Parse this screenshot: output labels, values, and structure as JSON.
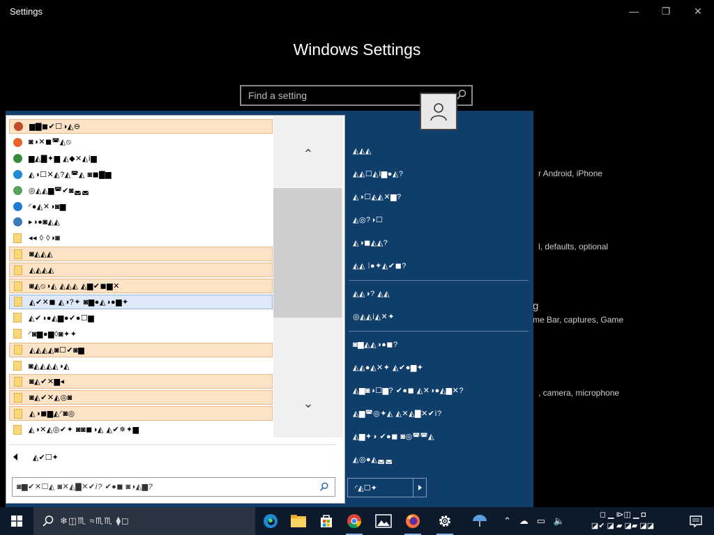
{
  "window": {
    "title": "Settings",
    "minimize": "—",
    "maximize": "❐",
    "close": "✕",
    "heading": "Windows Settings",
    "search_placeholder": "Find a setting",
    "bg_text": [
      "r Android, iPhone",
      "l, defaults, optional",
      "g",
      "me Bar, captures, Game",
      ", camera, microphone"
    ]
  },
  "start_menu": {
    "jump_list": [
      {
        "label": "▆▇◼✔☐◑◭⊖",
        "icon": "headphones-app-icon",
        "icon_color": "#c04a2a",
        "highlight": "hl"
      },
      {
        "label": "◙◑✕◼◚◭⦸",
        "icon": "firefox-icon",
        "icon_color": "#e8642a",
        "highlight": ""
      },
      {
        "label": "▆◭▇✦▆ ◭◆✕◭ⅰ▆",
        "icon": "chrome-icon",
        "icon_color": "#3b8a3b",
        "highlight": ""
      },
      {
        "label": "◭◑☐✕◭?◭◚◭ ◙◼▇▆",
        "icon": "edge-icon",
        "icon_color": "#1f8bd6",
        "highlight": ""
      },
      {
        "label": "◎◭◭▆◚✔◙◛◛",
        "icon": "notepad-icon",
        "icon_color": "#5aa05a",
        "highlight": ""
      },
      {
        "label": "◜●◭✕◑◙▆",
        "icon": "onedrive-icon",
        "icon_color": "#1f7ad6",
        "highlight": ""
      },
      {
        "label": "▸◑●◙◭◭",
        "icon": "app-installer-icon",
        "icon_color": "#3a7ab8",
        "highlight": ""
      },
      {
        "label": "◂◂ ◊ ◊◑◙",
        "icon": "folder-icon",
        "icon_color": "#f8d878",
        "highlight": ""
      },
      {
        "label": "◙◭◭◭",
        "icon": "folder-icon",
        "icon_color": "#f8d878",
        "highlight": "hl"
      },
      {
        "label": "◭◭◭◭",
        "icon": "folder-icon",
        "icon_color": "#f8d878",
        "highlight": "hl"
      },
      {
        "label": "◙◭⦸◑◭ ◭◭◭ ◭▆✔◼▆✕",
        "icon": "folder-icon",
        "icon_color": "#f8d878",
        "highlight": "hl"
      },
      {
        "label": "◭✔✕◼ ◭◑?✦ ◙▆●◭◑●▆✦",
        "icon": "folder-icon",
        "icon_color": "#f8d878",
        "highlight": "sel"
      },
      {
        "label": "◭✔◑●◭▆●✔●☐▆",
        "icon": "folder-icon",
        "icon_color": "#f8d878",
        "highlight": ""
      },
      {
        "label": "◜◙▆●▆◊◙✦✦",
        "icon": "folder-icon",
        "icon_color": "#f8d878",
        "highlight": ""
      },
      {
        "label": "◭◭◭◭◙☐✔◙▆",
        "icon": "folder-icon",
        "icon_color": "#f8d878",
        "highlight": "hl"
      },
      {
        "label": "◙◭◭◭◭◑◭",
        "icon": "folder-icon",
        "icon_color": "#f8d878",
        "highlight": ""
      },
      {
        "label": "◙◭✔✕▆◂",
        "icon": "folder-icon",
        "icon_color": "#f8d878",
        "highlight": "hl"
      },
      {
        "label": "◙◭✔✕◭◎◙",
        "icon": "folder-icon",
        "icon_color": "#f8d878",
        "highlight": "hl"
      },
      {
        "label": "◭◑◼▆◭◜◙◎",
        "icon": "folder-icon",
        "icon_color": "#f8d878",
        "highlight": "hl"
      },
      {
        "label": "◭◑✕◭◎✔✦ ◙◙◼◑◭ ◭✔✵✦▆",
        "icon": "folder-icon",
        "icon_color": "#f8d878",
        "highlight": ""
      }
    ],
    "scroll_up": "⌃",
    "scroll_down": "⌄",
    "back_label": "◭✔☐✦",
    "search_placeholder": "◙▆✔✕☐◭ ◙✕◭▇✕✔ⅰ? ✔●◼ ◙◑◭▆?",
    "right_items": [
      "◭◭◭",
      "◭◭☐◭ⅰ▆●◭?",
      "◭◑☐◭◭✕▆?",
      "◭◎?◑☐",
      "◭◑◼◭◭?",
      "◭◭ ⁞●✦◭✔◼?",
      "◭◭◑? ◭◭",
      "◎◭◭ⅰ◭✕✦",
      "◙▆◭◭◑●◼?",
      "◭◭●◭✕✦ ◭✔●▆✦",
      "◭▆◙◑☐▆? ✔●◼ ◭✕◑●◭▆✕?",
      "◭▆◚◎✦◭ ◭✕◭▇✕✔ⅰ?",
      "◭▆✦◑ ✔●◼ ◙◎◚◚◭",
      "◭◎●◭◛◛"
    ],
    "shutdown_label": "◜◭☐✦"
  },
  "taskbar": {
    "search_text": "❄◫♏ ≈♏♏ ⧫◻",
    "clock_line1": "◻ ▁ ⧐◫ ▁ ◘",
    "clock_line2": "◪✔ ◪ ▰ ◪▰ ◪◪"
  },
  "colors": {
    "menu_bg": "#0f3e6a",
    "taskbar_bg": "#0c1a2b",
    "highlight": "#fde3c6",
    "selected": "#dde9f8"
  }
}
